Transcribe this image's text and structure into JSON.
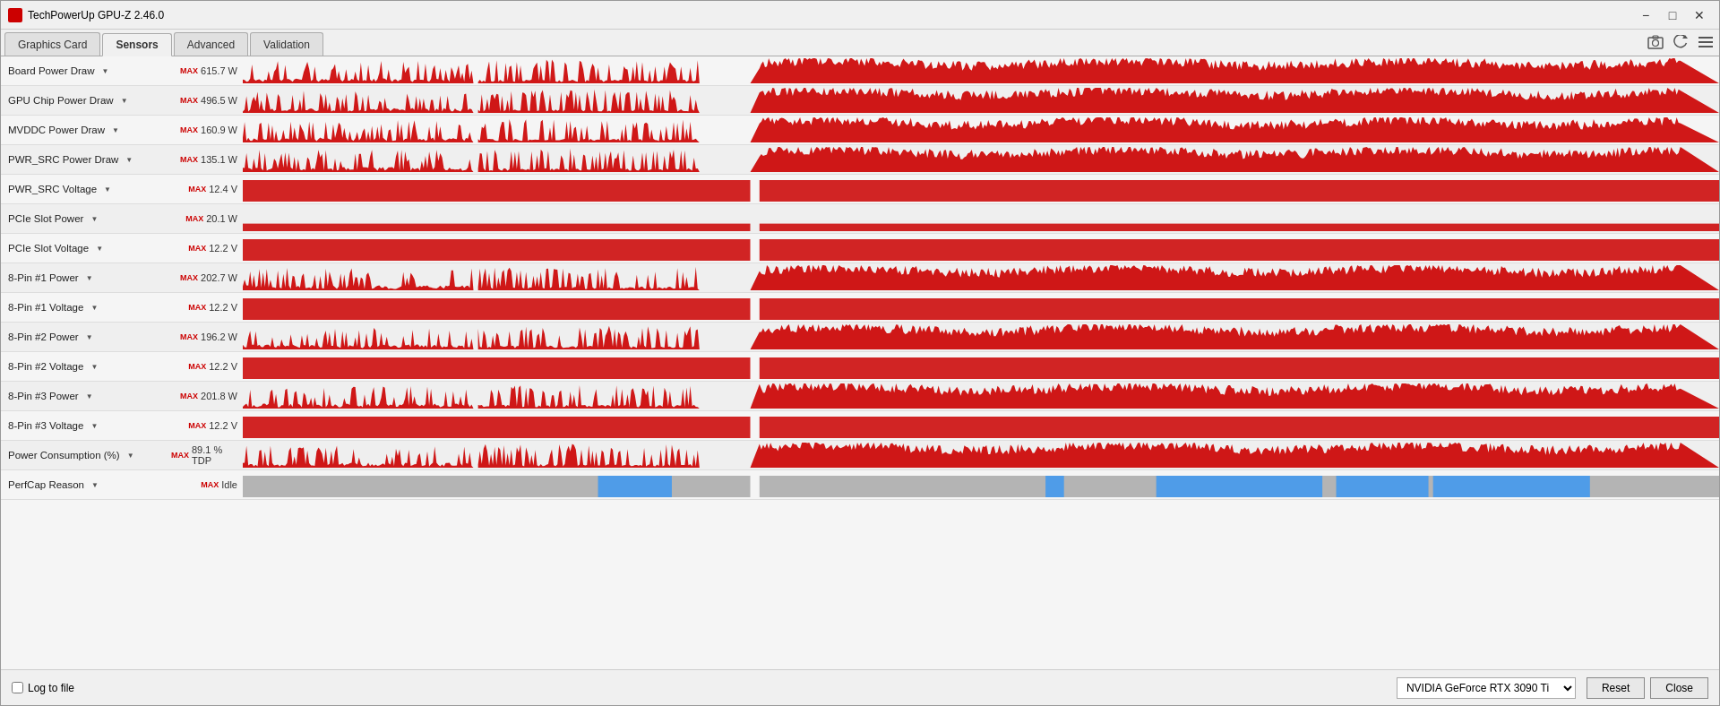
{
  "window": {
    "title": "TechPowerUp GPU-Z 2.46.0",
    "minimize_label": "−",
    "maximize_label": "□",
    "close_label": "✕"
  },
  "tabs": [
    {
      "id": "graphics-card",
      "label": "Graphics Card",
      "active": false
    },
    {
      "id": "sensors",
      "label": "Sensors",
      "active": true
    },
    {
      "id": "advanced",
      "label": "Advanced",
      "active": false
    },
    {
      "id": "validation",
      "label": "Validation",
      "active": false
    }
  ],
  "toolbar": {
    "screenshot_label": "📷",
    "refresh_label": "↺",
    "menu_label": "☰"
  },
  "sensors": [
    {
      "label": "Board Power Draw",
      "max": "615.7 W",
      "type": "power"
    },
    {
      "label": "GPU Chip Power Draw",
      "max": "496.5 W",
      "type": "power"
    },
    {
      "label": "MVDDC Power Draw",
      "max": "160.9 W",
      "type": "power"
    },
    {
      "label": "PWR_SRC Power Draw",
      "max": "135.1 W",
      "type": "power"
    },
    {
      "label": "PWR_SRC Voltage",
      "max": "12.4 V",
      "type": "voltage"
    },
    {
      "label": "PCIe Slot Power",
      "max": "20.1 W",
      "type": "power_small"
    },
    {
      "label": "PCIe Slot Voltage",
      "max": "12.2 V",
      "type": "voltage"
    },
    {
      "label": "8-Pin #1 Power",
      "max": "202.7 W",
      "type": "power"
    },
    {
      "label": "8-Pin #1 Voltage",
      "max": "12.2 V",
      "type": "voltage"
    },
    {
      "label": "8-Pin #2 Power",
      "max": "196.2 W",
      "type": "power"
    },
    {
      "label": "8-Pin #2 Voltage",
      "max": "12.2 V",
      "type": "voltage"
    },
    {
      "label": "8-Pin #3 Power",
      "max": "201.8 W",
      "type": "power"
    },
    {
      "label": "8-Pin #3 Voltage",
      "max": "12.2 V",
      "type": "voltage"
    },
    {
      "label": "Power Consumption (%)",
      "max": "89.1 % TDP",
      "type": "power"
    },
    {
      "label": "PerfCap Reason",
      "max": "Idle",
      "type": "perfcap"
    }
  ],
  "footer": {
    "log_label": "Log to file",
    "gpu_options": [
      "NVIDIA GeForce RTX 3090 Ti"
    ],
    "gpu_selected": "NVIDIA GeForce RTX 3090 Ti",
    "reset_label": "Reset",
    "close_label": "Close"
  },
  "max_label": "MAX"
}
